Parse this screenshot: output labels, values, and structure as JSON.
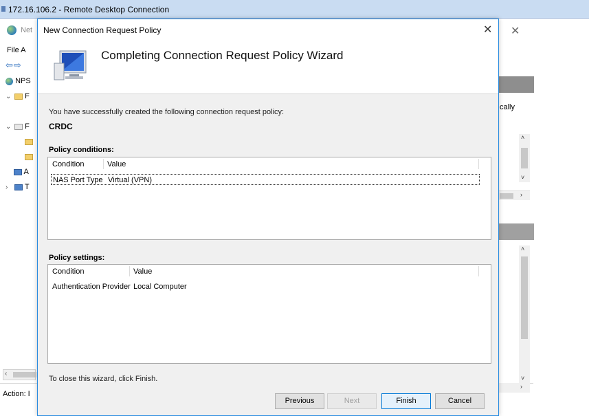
{
  "rdp": {
    "title": "172.16.106.2 - Remote Desktop Connection"
  },
  "background": {
    "window_title": "Net",
    "menu": "File  A",
    "tree": [
      "NPS",
      "F",
      "",
      "F",
      "",
      "",
      "A",
      "T"
    ],
    "right_text": "cally",
    "status": "Action: I"
  },
  "dialog": {
    "title": "New Connection Request Policy",
    "heading": "Completing Connection Request Policy Wizard",
    "intro": "You have successfully created the following connection request policy:",
    "policy_name": "CRDC",
    "conditions": {
      "label": "Policy conditions:",
      "columns": [
        "Condition",
        "Value"
      ],
      "rows": [
        {
          "condition": "NAS Port Type",
          "value": "Virtual (VPN)"
        }
      ]
    },
    "settings": {
      "label": "Policy settings:",
      "columns": [
        "Condition",
        "Value"
      ],
      "rows": [
        {
          "condition": "Authentication Provider",
          "value": "Local Computer"
        }
      ]
    },
    "close_hint": "To close this wizard, click Finish.",
    "buttons": {
      "previous": "Previous",
      "next": "Next",
      "finish": "Finish",
      "cancel": "Cancel"
    }
  }
}
